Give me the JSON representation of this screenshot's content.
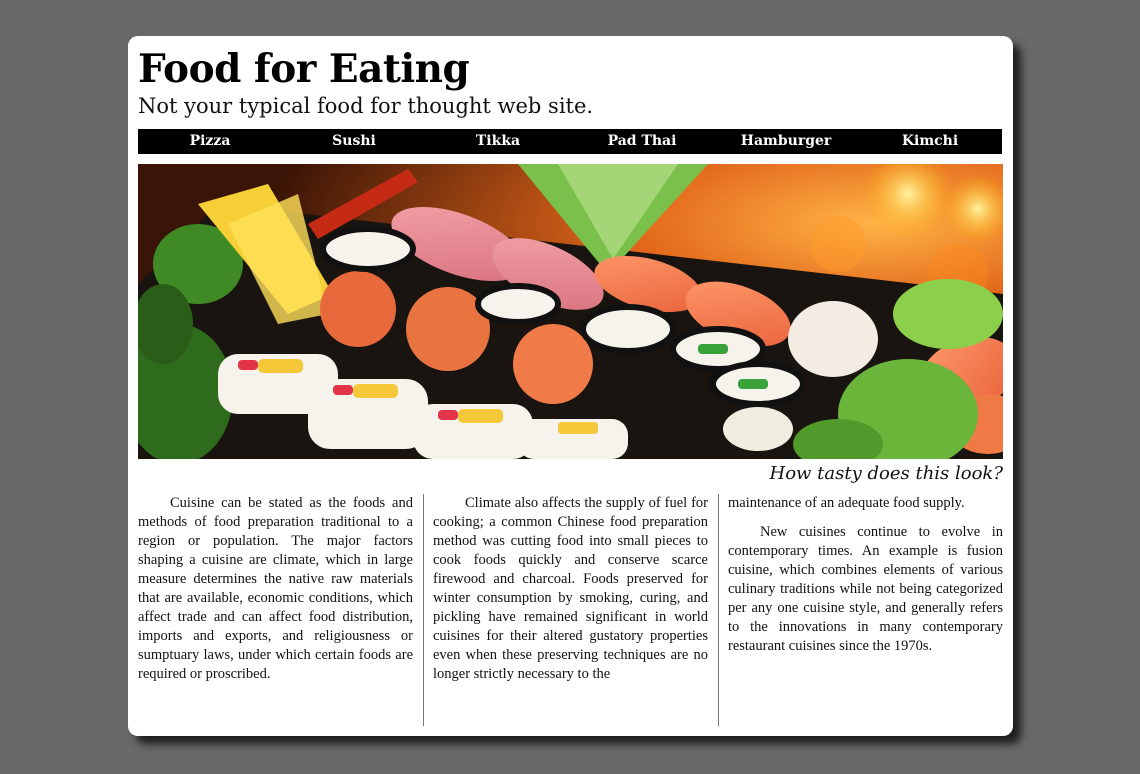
{
  "site": {
    "title": "Food for Eating",
    "tagline": "Not your typical food for thought web site."
  },
  "nav": {
    "items": [
      "Pizza",
      "Sushi",
      "Tikka",
      "Pad Thai",
      "Hamburger",
      "Kimchi"
    ]
  },
  "hero": {
    "image": "sushi-platter-photo",
    "caption": "How tasty does this look?"
  },
  "article": {
    "col1_p1": "Cuisine can be stated as the foods and methods of food preparation traditional to a region or population. The major factors shaping a cuisine are climate, which in large measure determines the native raw materials that are available, economic conditions, which affect trade and can affect food distribution, imports and exports, and religiousness or sumptuary laws, under which certain foods are required or proscribed.",
    "col2_p1": "Climate also affects the supply of fuel for cooking; a common Chinese food preparation method was cutting food into small pieces to cook foods quickly and conserve scarce firewood and charcoal. Foods preserved for winter consumption by smoking, curing, and pickling have remained significant in world cuisines for their altered gustatory properties even when these preserving techniques are no longer strictly necessary to the",
    "col3_cont": "maintenance of an adequate food supply.",
    "col3_p2": "New cuisines continue to evolve in contemporary times. An example is fusion cuisine, which combines elements of various culinary traditions while not being categorized per any one cuisine style, and generally refers to the innovations in many contemporary restaurant cuisines since the 1970s."
  },
  "colors": {
    "background": "#686868",
    "card": "#ffffff",
    "nav_bar": "#000000",
    "nav_text": "#ffffff"
  }
}
